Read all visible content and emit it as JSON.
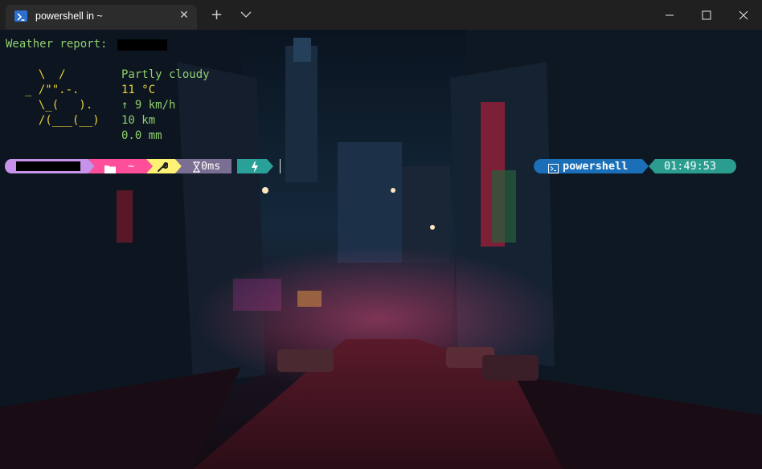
{
  "window": {
    "tab_title": "powershell in ~",
    "tab_icon": "powershell-icon",
    "new_tab_label": "+"
  },
  "weather": {
    "heading": "Weather report:",
    "art": [
      "  \\  /",
      "_ /\"\".-.",
      "  \\_(   ).",
      "  /(___(__)"
    ],
    "condition": "Partly cloudy",
    "temperature": "11 °C",
    "wind": "↑ 9 km/h",
    "visibility": "10 km",
    "precipitation": "0.0 mm"
  },
  "prompt": {
    "path": "~",
    "exec_time": "0ms",
    "shell": "powershell",
    "time": "01:49:53",
    "colors": {
      "user": "#c792ea",
      "folder": "#ff4f9a",
      "git": "#fff176",
      "exec": "#7a6f92",
      "root": "#2aa198",
      "shell": "#1b6fb8",
      "time": "#2a9d8f"
    }
  }
}
